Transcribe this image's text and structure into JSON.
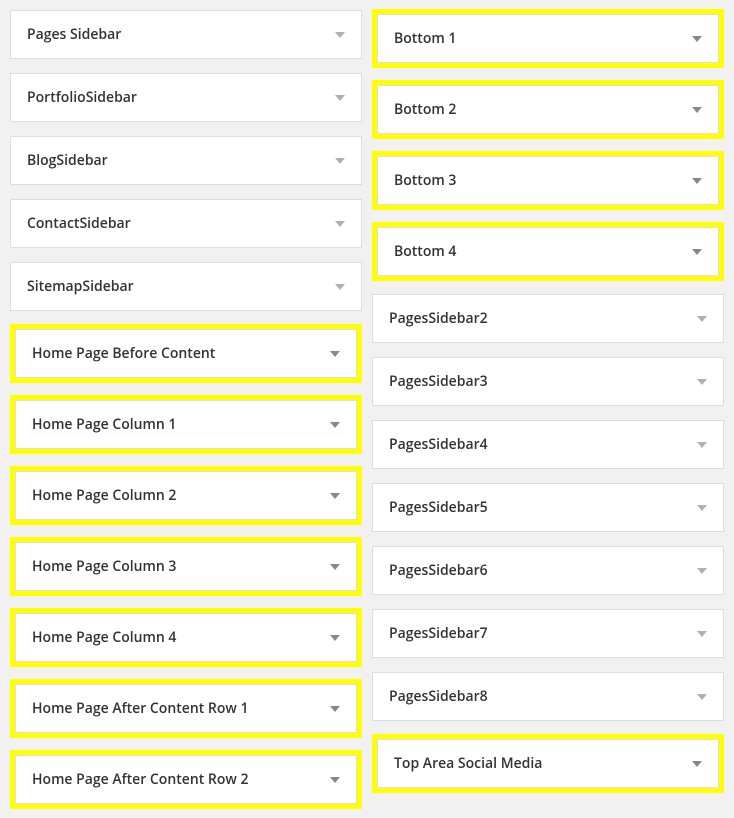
{
  "left": [
    {
      "label": "Pages Sidebar",
      "highlighted": false
    },
    {
      "label": "PortfolioSidebar",
      "highlighted": false
    },
    {
      "label": "BlogSidebar",
      "highlighted": false
    },
    {
      "label": "ContactSidebar",
      "highlighted": false
    },
    {
      "label": "SitemapSidebar",
      "highlighted": false
    },
    {
      "label": "Home Page Before Content",
      "highlighted": true
    },
    {
      "label": "Home Page Column 1",
      "highlighted": true
    },
    {
      "label": "Home Page Column 2",
      "highlighted": true
    },
    {
      "label": "Home Page Column 3",
      "highlighted": true
    },
    {
      "label": "Home Page Column 4",
      "highlighted": true
    },
    {
      "label": "Home Page After Content Row 1",
      "highlighted": true
    },
    {
      "label": "Home Page After Content Row 2",
      "highlighted": true
    }
  ],
  "right": [
    {
      "label": "Bottom 1",
      "highlighted": true
    },
    {
      "label": "Bottom 2",
      "highlighted": true
    },
    {
      "label": "Bottom 3",
      "highlighted": true
    },
    {
      "label": "Bottom 4",
      "highlighted": true
    },
    {
      "label": "PagesSidebar2",
      "highlighted": false
    },
    {
      "label": "PagesSidebar3",
      "highlighted": false
    },
    {
      "label": "PagesSidebar4",
      "highlighted": false
    },
    {
      "label": "PagesSidebar5",
      "highlighted": false
    },
    {
      "label": "PagesSidebar6",
      "highlighted": false
    },
    {
      "label": "PagesSidebar7",
      "highlighted": false
    },
    {
      "label": "PagesSidebar8",
      "highlighted": false
    },
    {
      "label": "Top Area Social Media",
      "highlighted": true
    }
  ]
}
